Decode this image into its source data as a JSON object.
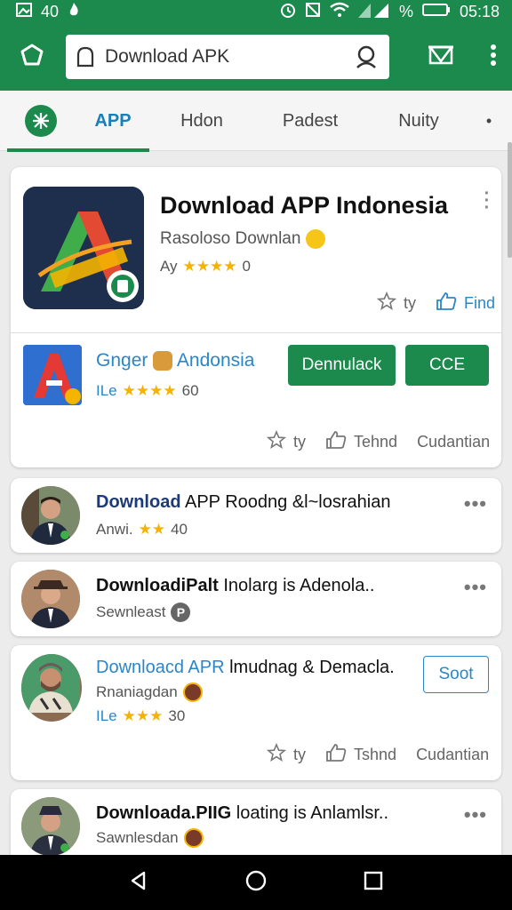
{
  "statusbar": {
    "left_text": "40",
    "time": "05:18",
    "battery_text": "%"
  },
  "search": {
    "value": "Download APK"
  },
  "tabs": [
    {
      "label": "APP",
      "active": true
    },
    {
      "label": "Hdon"
    },
    {
      "label": "Padest"
    },
    {
      "label": "Nuity"
    }
  ],
  "featured": {
    "title": "Download APP  Indonesia",
    "subtitle": "Rasoloso Downlan",
    "rating_prefix": "Ay",
    "rating_stars": "★★★★",
    "rating_value": "0",
    "action_1": "ty",
    "action_2": "Find"
  },
  "sub_app": {
    "title_a": "Gnger",
    "title_b": "Andonsia",
    "rating_prefix": "ILe",
    "rating_stars": "★★★★",
    "rating_value": "60",
    "button_1": "Dennulack",
    "button_2": "CCE",
    "action_1": "ty",
    "action_2": "Tehnd",
    "action_3": "Cudantian"
  },
  "rows": [
    {
      "title_bold": "Download",
      "title_rest": " APP Roodng &l~losrahian",
      "sub_text": "Anwi.",
      "sub_stars": "★★",
      "sub_value": "40",
      "dots": "•••"
    },
    {
      "title_bold": "DownloadiPalt",
      "title_rest": " Inolarg is Adenola..",
      "sub_text": "Sewnleast",
      "sub_badge": "P",
      "dots": "•••"
    },
    {
      "title_blue": "Downloacd APR",
      "title_rest": " lmudnag & Demacla.",
      "sub_text": "Rnaniagdan",
      "rating_prefix": "ILe",
      "rating_stars": "★★★",
      "rating_value": "30",
      "button": "Soot",
      "action_1": "ty",
      "action_2": "Tshnd",
      "action_3": "Cudantian"
    },
    {
      "title_bold": "Downloada.PIIG",
      "title_rest": " loating is Anlamlsr..",
      "sub_text": "Sawnlesdan",
      "dots": "•••"
    }
  ],
  "colors": {
    "primary": "#1b8a4c",
    "accent_blue": "#2a86c8",
    "star": "#f5b301"
  }
}
